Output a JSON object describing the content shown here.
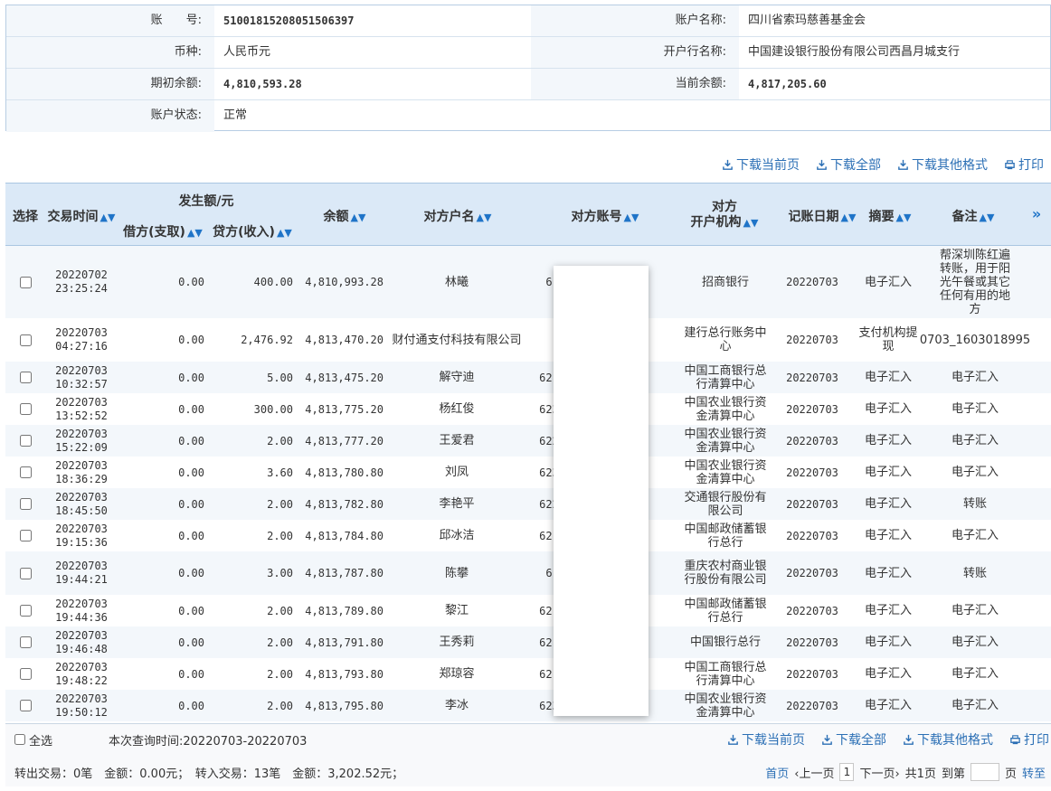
{
  "account": {
    "no_label": "账　　号:",
    "no": "51001815208051506397",
    "name_label": "账户名称:",
    "name": "四川省索玛慈善基金会",
    "currency_label": "币种:",
    "currency": "人民币元",
    "bank_label": "开户行名称:",
    "bank": "中国建设银行股份有限公司西昌月城支行",
    "opening_label": "期初余额:",
    "opening": "4,810,593.28",
    "current_label": "当前余额:",
    "current": "4,817,205.60",
    "status_label": "账户状态:",
    "status": "正常"
  },
  "tools": {
    "download_page": "下载当前页",
    "download_all": "下载全部",
    "download_other": "下载其他格式",
    "print": "打印"
  },
  "headers": {
    "select": "选择",
    "time": "交易时间",
    "amount_group": "发生额/元",
    "debit": "借方(支取)",
    "credit": "贷方(收入)",
    "balance": "余额",
    "payee_name": "对方户名",
    "payee_account": "对方账号",
    "payee_bank_1": "对方",
    "payee_bank_2": "开户机构",
    "book_date": "记账日期",
    "summary": "摘要",
    "remark": "备注",
    "more": "»"
  },
  "rows": [
    {
      "date": "20220702",
      "time": "23:25:24",
      "debit": "0.00",
      "credit": "400.00",
      "balance": "4,810,993.28",
      "name": "林曦",
      "acct": "6",
      "bank": "招商银行",
      "book": "20220703",
      "summary": "电子汇入",
      "remark": "帮深圳陈红遍转账，用于阳光午餐或其它任何有用的地方"
    },
    {
      "date": "20220703",
      "time": "04:27:16",
      "debit": "0.00",
      "credit": "2,476.92",
      "balance": "4,813,470.20",
      "name": "财付通支付科技有限公司",
      "acct": "",
      "bank": "建行总行账务中心",
      "book": "20220703",
      "summary": "支付机构提现",
      "remark": "0703_1603018995"
    },
    {
      "date": "20220703",
      "time": "10:32:57",
      "debit": "0.00",
      "credit": "5.00",
      "balance": "4,813,475.20",
      "name": "解守迪",
      "acct": "621",
      "bank": "中国工商银行总行清算中心",
      "book": "20220703",
      "summary": "电子汇入",
      "remark": "电子汇入"
    },
    {
      "date": "20220703",
      "time": "13:52:52",
      "debit": "0.00",
      "credit": "300.00",
      "balance": "4,813,775.20",
      "name": "杨红俊",
      "acct": "623",
      "bank": "中国农业银行资金清算中心",
      "book": "20220703",
      "summary": "电子汇入",
      "remark": "电子汇入"
    },
    {
      "date": "20220703",
      "time": "15:22:09",
      "debit": "0.00",
      "credit": "2.00",
      "balance": "4,813,777.20",
      "name": "王爱君",
      "acct": "622",
      "bank": "中国农业银行资金清算中心",
      "book": "20220703",
      "summary": "电子汇入",
      "remark": "电子汇入"
    },
    {
      "date": "20220703",
      "time": "18:36:29",
      "debit": "0.00",
      "credit": "3.60",
      "balance": "4,813,780.80",
      "name": "刘凤",
      "acct": "623",
      "bank": "中国农业银行资金清算中心",
      "book": "20220703",
      "summary": "电子汇入",
      "remark": "电子汇入"
    },
    {
      "date": "20220703",
      "time": "18:45:50",
      "debit": "0.00",
      "credit": "2.00",
      "balance": "4,813,782.80",
      "name": "李艳平",
      "acct": "622",
      "bank": "交通银行股份有限公司",
      "book": "20220703",
      "summary": "电子汇入",
      "remark": "转账"
    },
    {
      "date": "20220703",
      "time": "19:15:36",
      "debit": "0.00",
      "credit": "2.00",
      "balance": "4,813,784.80",
      "name": "邱冰洁",
      "acct": "621",
      "bank": "中国邮政储蓄银行总行",
      "book": "20220703",
      "summary": "电子汇入",
      "remark": "电子汇入"
    },
    {
      "date": "20220703",
      "time": "19:44:21",
      "debit": "0.00",
      "credit": "3.00",
      "balance": "4,813,787.80",
      "name": "陈攀",
      "acct": "6",
      "bank": "重庆农村商业银行股份有限公司",
      "book": "20220703",
      "summary": "电子汇入",
      "remark": "转账"
    },
    {
      "date": "20220703",
      "time": "19:44:36",
      "debit": "0.00",
      "credit": "2.00",
      "balance": "4,813,789.80",
      "name": "黎江",
      "acct": "621",
      "bank": "中国邮政储蓄银行总行",
      "book": "20220703",
      "summary": "电子汇入",
      "remark": "电子汇入"
    },
    {
      "date": "20220703",
      "time": "19:46:48",
      "debit": "0.00",
      "credit": "2.00",
      "balance": "4,813,791.80",
      "name": "王秀莉",
      "acct": "621",
      "bank": "中国银行总行",
      "book": "20220703",
      "summary": "电子汇入",
      "remark": "电子汇入"
    },
    {
      "date": "20220703",
      "time": "19:48:22",
      "debit": "0.00",
      "credit": "2.00",
      "balance": "4,813,793.80",
      "name": "郑琼容",
      "acct": "621",
      "bank": "中国工商银行总行清算中心",
      "book": "20220703",
      "summary": "电子汇入",
      "remark": "电子汇入"
    },
    {
      "date": "20220703",
      "time": "19:50:12",
      "debit": "0.00",
      "credit": "2.00",
      "balance": "4,813,795.80",
      "name": "李冰",
      "acct": "623",
      "bank": "中国农业银行资金清算中心",
      "book": "20220703",
      "summary": "电子汇入",
      "remark": "电子汇入"
    }
  ],
  "footer": {
    "select_all": "全选",
    "query_time": "本次查询时间:20220703-20220703",
    "summary_out": "转出交易：0笔　金额：0.00元；　转入交易：13笔　金额：3,202.52元；",
    "first": "首页",
    "prev": "‹上一页",
    "page": "1",
    "next": "下一页›",
    "total": "共1页",
    "goto": "到第",
    "page_unit": "页",
    "jump": "转至"
  },
  "colors": {
    "header_bg": "#dbe9f7",
    "link": "#2b6fb5",
    "sort_icon": "#1f74c8"
  }
}
